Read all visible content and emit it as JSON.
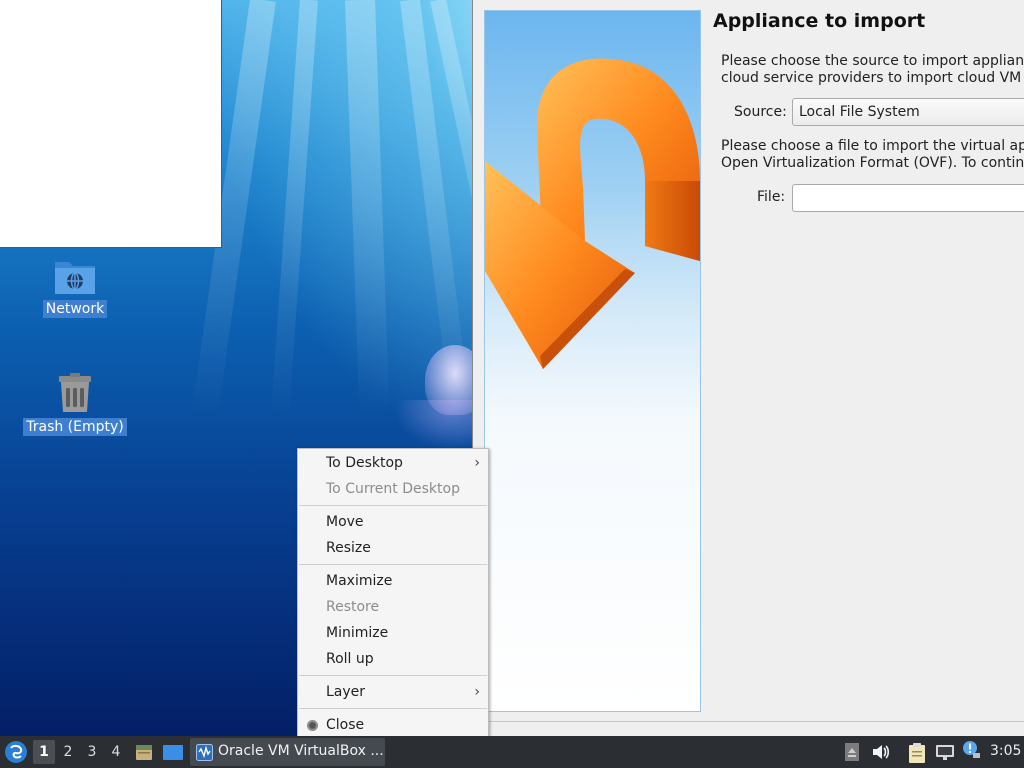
{
  "desktop": {
    "icons": [
      {
        "label": "Network",
        "icon": "network-folder-icon"
      },
      {
        "label": "Trash (Empty)",
        "icon": "trash-icon"
      }
    ]
  },
  "dialog": {
    "title": "Appliance to import",
    "intro_text_1": "Please choose the source to import appliance",
    "intro_text_2": "cloud service providers to import cloud VM fr",
    "source_label": "Source:",
    "source_value": "Local File System",
    "file_text_1": "Please choose a file to import the virtual app",
    "file_text_2": "Open Virtualization Format (OVF). To continu",
    "file_label": "File:",
    "file_value": "",
    "banner_icon": "orange-import-arrow-icon"
  },
  "context_menu": {
    "items": [
      {
        "label": "To Desktop",
        "submenu": true,
        "disabled": false
      },
      {
        "label": "To Current Desktop",
        "submenu": false,
        "disabled": true
      },
      {
        "label": "Move",
        "submenu": false,
        "disabled": false
      },
      {
        "label": "Resize",
        "submenu": false,
        "disabled": false
      },
      {
        "label": "Maximize",
        "submenu": false,
        "disabled": false
      },
      {
        "label": "Restore",
        "submenu": false,
        "disabled": true
      },
      {
        "label": "Minimize",
        "submenu": false,
        "disabled": false
      },
      {
        "label": "Roll up",
        "submenu": false,
        "disabled": false
      },
      {
        "label": "Layer",
        "submenu": true,
        "disabled": false
      },
      {
        "label": "Close",
        "submenu": false,
        "disabled": false
      }
    ],
    "arrow_glyph": "›"
  },
  "taskbar": {
    "workspaces": [
      "1",
      "2",
      "3",
      "4"
    ],
    "active_workspace": "1",
    "task_label": "Oracle VM VirtualBox ...",
    "clock": "3:05",
    "tray_icons": [
      "eject-icon",
      "volume-icon",
      "clipboard-icon",
      "network-icon",
      "update-notifier-icon"
    ]
  },
  "colors": {
    "taskbar_bg": "#2b2f33",
    "icon_label_bg": "#3f7fd0",
    "dialog_bg": "#efefef",
    "menu_bg": "#f5f5f5"
  }
}
